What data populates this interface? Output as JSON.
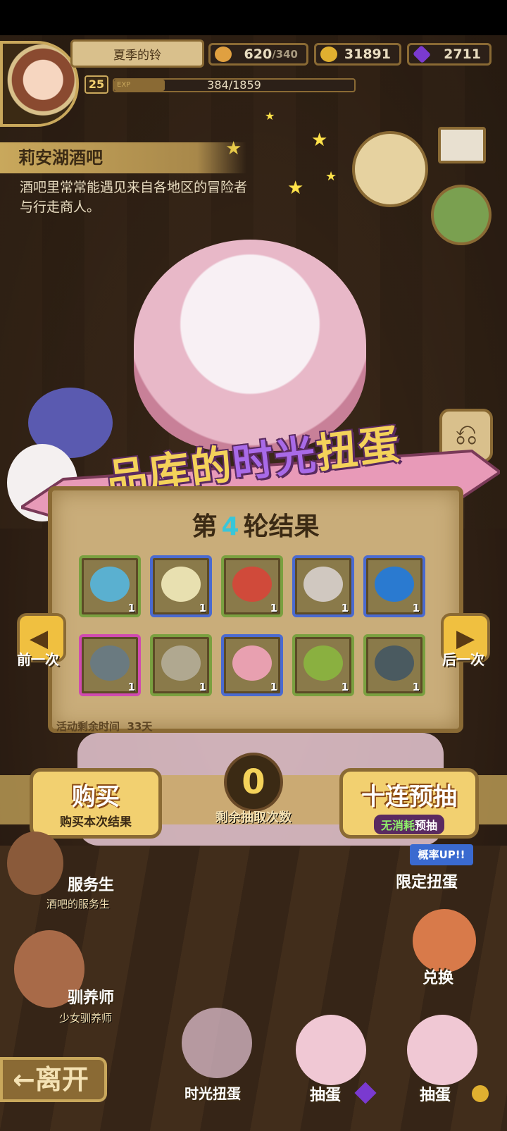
{
  "player": {
    "name": "夏季的铃",
    "level": "25",
    "exp_label": "EXP",
    "exp_value": "384/1859",
    "exp_fraction": 0.21
  },
  "resources": [
    {
      "name": "stamina",
      "value": "620",
      "max": "/340",
      "color": "#e0a040"
    },
    {
      "name": "gold",
      "value": "31891",
      "color": "#e0b030"
    },
    {
      "name": "gem",
      "value": "2711",
      "color": "#7a3ad0"
    }
  ],
  "location": {
    "title": "莉安湖酒吧",
    "description": "酒吧里常常能遇见来自各地区的冒险者与行走商人。"
  },
  "gacha": {
    "title_a": "品库的",
    "title_b": "时光",
    "title_c": "扭蛋",
    "round_prefix": "第",
    "round_number": "4",
    "round_suffix": "轮结果",
    "items": [
      {
        "name": "shell",
        "qty": "1",
        "rarity": "green",
        "color": "#5ab0d0"
      },
      {
        "name": "seed-pod",
        "qty": "1",
        "rarity": "blue",
        "color": "#e8e0b0"
      },
      {
        "name": "crab",
        "qty": "1",
        "rarity": "green",
        "color": "#d04a3a"
      },
      {
        "name": "spiked-egg",
        "qty": "1",
        "rarity": "blue",
        "color": "#d0c8c0"
      },
      {
        "name": "blue-orb",
        "qty": "1",
        "rarity": "blue",
        "color": "#2a7ad0"
      },
      {
        "name": "hammer",
        "qty": "1",
        "rarity": "pink",
        "color": "#6a7a80"
      },
      {
        "name": "feather-leaf",
        "qty": "1",
        "rarity": "green",
        "color": "#b0a890"
      },
      {
        "name": "bow-hat",
        "qty": "1",
        "rarity": "blue",
        "color": "#e8a0b0"
      },
      {
        "name": "sprout",
        "qty": "1",
        "rarity": "green",
        "color": "#8ab040"
      },
      {
        "name": "turtle-shell",
        "qty": "1",
        "rarity": "green",
        "color": "#4a5a60"
      }
    ],
    "timer_label": "活动剩余时间",
    "timer_value": "33天",
    "prev_label": "前一次",
    "next_label": "后一次",
    "buy_label": "购买",
    "buy_sub": "购买本次结果",
    "remaining_count": "0",
    "remaining_label": "剩余抽取次数",
    "ten_label": "十连预抽",
    "ten_sub_a": "无消耗",
    "ten_sub_b": "预抽"
  },
  "npcs": [
    {
      "title": "服务生",
      "subtitle": "酒吧的服务生"
    },
    {
      "title": "驯养师",
      "subtitle": "少女驯养师"
    }
  ],
  "side_buttons": {
    "limited_tag": "概率UP!!",
    "limited": "限定扭蛋",
    "exchange": "兑换"
  },
  "bottom": {
    "leave": "←离开",
    "time_gacha": "时光扭蛋",
    "draw_gem": "抽蛋",
    "draw_gold": "抽蛋"
  }
}
